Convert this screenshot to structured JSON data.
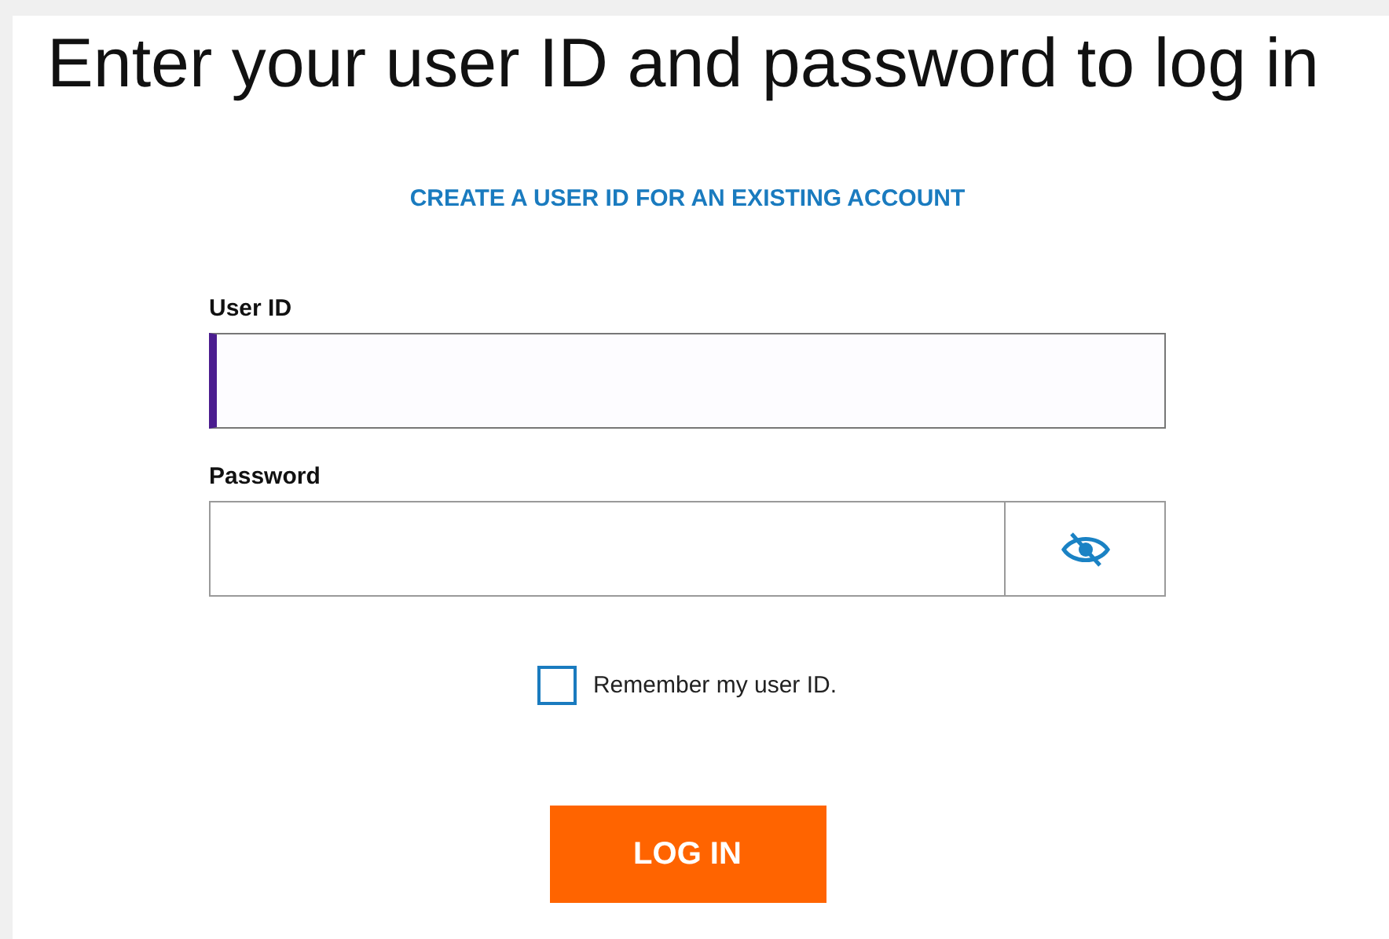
{
  "title": "Enter your user ID and password to log in",
  "create_link": "CREATE A USER ID FOR AN EXISTING ACCOUNT",
  "fields": [
    {
      "kind": "text",
      "label": "User ID",
      "focused": true
    },
    {
      "kind": "password",
      "label": "Password",
      "focused": false
    }
  ],
  "remember": {
    "label": "Remember my user ID.",
    "checked": false
  },
  "login_button": "LOG IN"
}
